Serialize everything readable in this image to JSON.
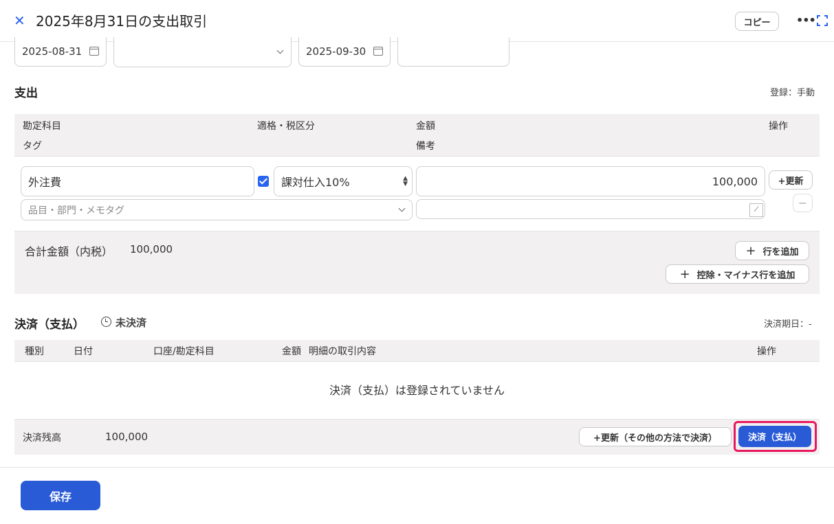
{
  "header": {
    "close_icon": "close-icon",
    "title": "2025年8月31日の支出取引",
    "copy_label": "コピー",
    "more_icon": "more-icon",
    "expand_icon": "expand-icon"
  },
  "top_fields": {
    "issue_date": "2025-08-31",
    "partner_value": "",
    "due_date": "2025-09-30",
    "ref_value": ""
  },
  "expense": {
    "title": "支出",
    "registration": "登録：手動",
    "headers": {
      "account": "勘定科目",
      "tax": "適格・税区分",
      "amount": "金額",
      "action": "操作",
      "tag": "タグ",
      "note": "備考"
    },
    "row": {
      "account": "外注費",
      "qualified_checked": true,
      "tax_category": "課対仕入10%",
      "amount": "100,000",
      "update_label": "+更新",
      "tag_placeholder": "品目・部門・メモタグ",
      "note": "",
      "remove_label": "−"
    },
    "total_label": "合計金額（内税）",
    "total_value": "100,000",
    "add_row_label": "行を追加",
    "add_deduction_label": "控除・マイナス行を追加"
  },
  "settlement": {
    "title": "決済（支払）",
    "status": "未決済",
    "due_label": "決済期日：-",
    "headers": {
      "type": "種別",
      "date": "日付",
      "account": "口座/勘定科目",
      "amount": "金額",
      "detail": "明細の取引内容",
      "action": "操作"
    },
    "empty_message": "決済（支払）は登録されていません",
    "balance_label": "決済残高",
    "balance_value": "100,000",
    "other_method_label": "+更新（その他の方法で決済）",
    "pay_label": "決済（支払）"
  },
  "footer": {
    "save_label": "保存"
  },
  "colors": {
    "accent": "#2a5bd7",
    "highlight": "#e8185f"
  }
}
